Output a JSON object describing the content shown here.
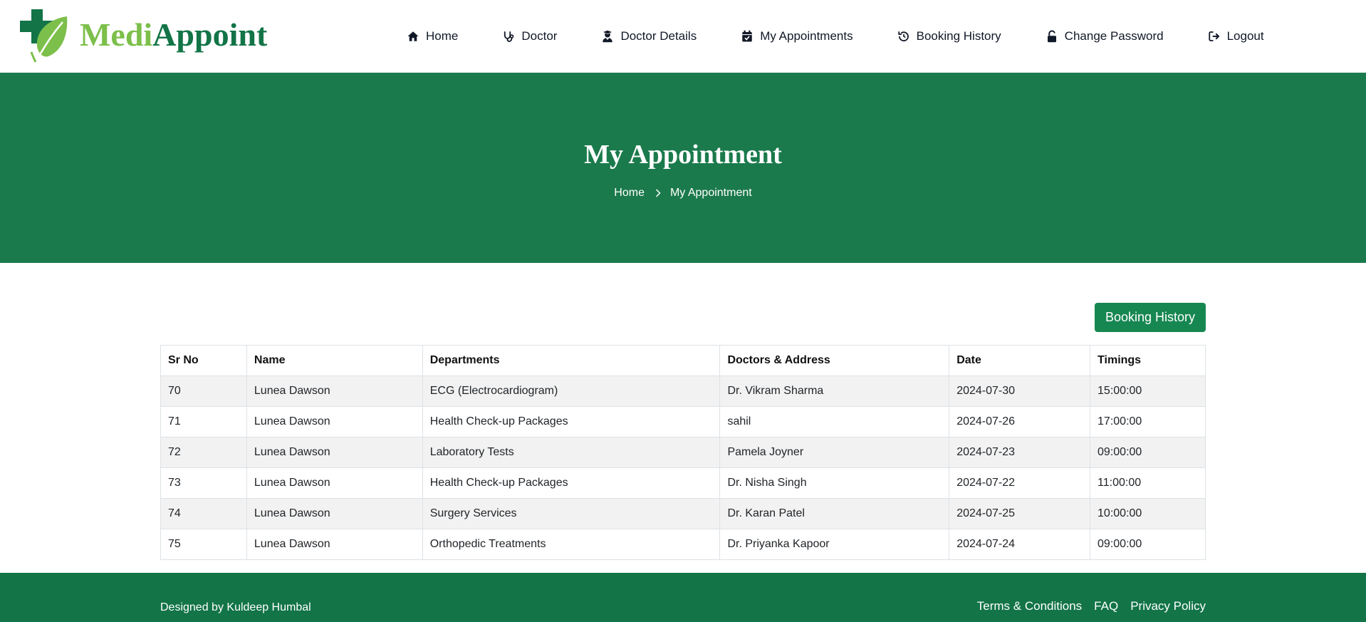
{
  "brand": {
    "part1": "Medi",
    "part2": "Appoint"
  },
  "nav": [
    {
      "label": "Home",
      "icon": "home-icon"
    },
    {
      "label": "Doctor",
      "icon": "stethoscope-icon"
    },
    {
      "label": "Doctor Details",
      "icon": "user-doctor-icon"
    },
    {
      "label": "My Appointments",
      "icon": "calendar-check-icon"
    },
    {
      "label": "Booking History",
      "icon": "history-icon"
    },
    {
      "label": "Change Password",
      "icon": "unlock-icon"
    },
    {
      "label": "Logout",
      "icon": "logout-icon"
    }
  ],
  "hero": {
    "title": "My Appointment",
    "breadcrumb": {
      "home": "Home",
      "current": "My Appointment"
    }
  },
  "actions": {
    "booking_history": "Booking History"
  },
  "table": {
    "headers": [
      "Sr No",
      "Name",
      "Departments",
      "Doctors & Address",
      "Date",
      "Timings"
    ],
    "rows": [
      [
        "70",
        "Lunea Dawson",
        "ECG (Electrocardiogram)",
        "Dr. Vikram Sharma",
        "2024-07-30",
        "15:00:00"
      ],
      [
        "71",
        "Lunea Dawson",
        "Health Check-up Packages",
        "sahil",
        "2024-07-26",
        "17:00:00"
      ],
      [
        "72",
        "Lunea Dawson",
        "Laboratory Tests",
        "Pamela Joyner",
        "2024-07-23",
        "09:00:00"
      ],
      [
        "73",
        "Lunea Dawson",
        "Health Check-up Packages",
        "Dr. Nisha Singh",
        "2024-07-22",
        "11:00:00"
      ],
      [
        "74",
        "Lunea Dawson",
        "Surgery Services",
        "Dr. Karan Patel",
        "2024-07-25",
        "10:00:00"
      ],
      [
        "75",
        "Lunea Dawson",
        "Orthopedic Treatments",
        "Dr. Priyanka Kapoor",
        "2024-07-24",
        "09:00:00"
      ]
    ]
  },
  "footer": {
    "credit": "Designed by Kuldeep Humbal",
    "links": [
      "Terms & Conditions",
      "FAQ",
      "Privacy Policy"
    ]
  },
  "colors": {
    "primary_green": "#1b7a4c",
    "dark_green": "#127447",
    "button_green": "#178752",
    "logo_light_green": "#7cbf4a"
  }
}
